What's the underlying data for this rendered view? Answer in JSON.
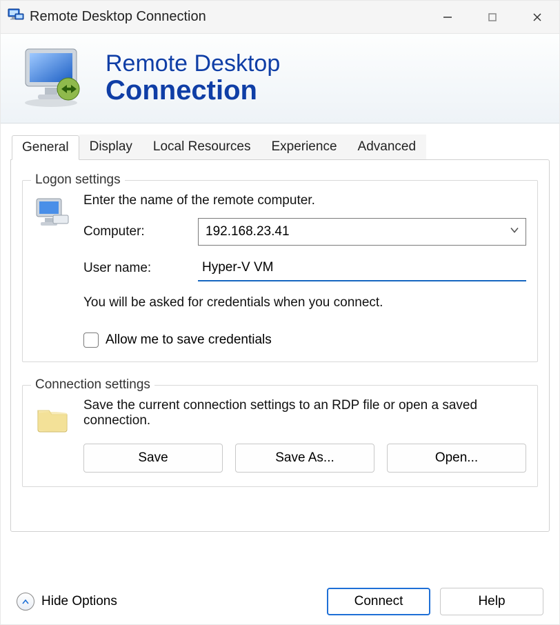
{
  "window": {
    "title": "Remote Desktop Connection"
  },
  "header": {
    "line1": "Remote Desktop",
    "line2": "Connection"
  },
  "tabs": [
    "General",
    "Display",
    "Local Resources",
    "Experience",
    "Advanced"
  ],
  "logon": {
    "legend": "Logon settings",
    "instruction": "Enter the name of the remote computer.",
    "computer_label": "Computer:",
    "computer_value": "192.168.23.41",
    "username_label": "User name:",
    "username_value": "Hyper-V VM",
    "note": "You will be asked for credentials when you connect.",
    "save_creds_label": "Allow me to save credentials",
    "save_creds_checked": false
  },
  "connection": {
    "legend": "Connection settings",
    "instruction": "Save the current connection settings to an RDP file or open a saved connection.",
    "save_label": "Save",
    "save_as_label": "Save As...",
    "open_label": "Open..."
  },
  "footer": {
    "hide_options": "Hide Options",
    "connect": "Connect",
    "help": "Help"
  }
}
